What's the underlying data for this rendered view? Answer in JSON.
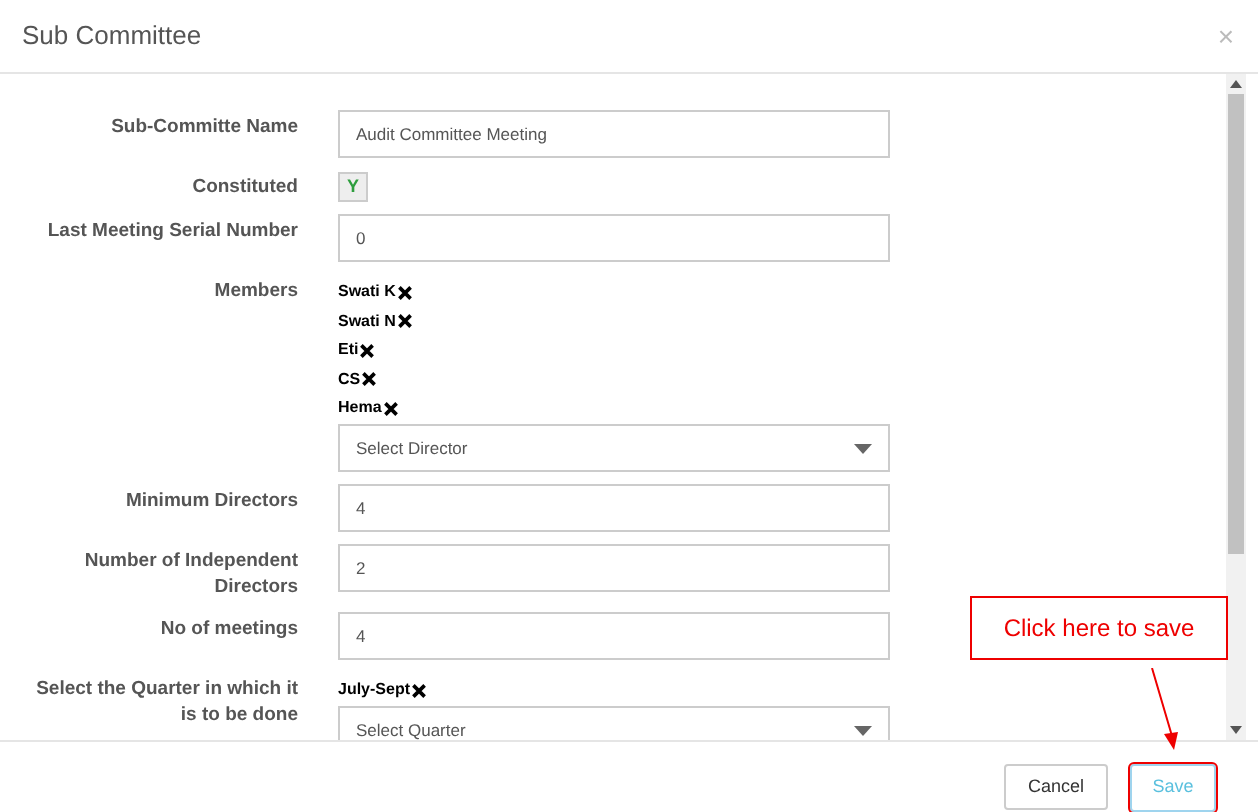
{
  "dialog": {
    "title": "Sub Committee",
    "close": "×"
  },
  "fields": [
    {
      "kind": "text",
      "label": "Sub-Committe Name",
      "value": "Audit Committee Meeting"
    },
    {
      "kind": "toggle",
      "label": "Constituted",
      "value": "Y",
      "on": true
    },
    {
      "kind": "text",
      "label": "Last Meeting Serial Number",
      "value": "0"
    },
    {
      "kind": "multi",
      "label": "Members",
      "tags": [
        "Swati K",
        "Swati N",
        "Eti",
        "CS",
        "Hema"
      ],
      "placeholder": "Select Director"
    },
    {
      "kind": "text",
      "label": "Minimum Directors",
      "value": "4"
    },
    {
      "kind": "text",
      "label": "Number of Independent Directors",
      "value": "2"
    },
    {
      "kind": "text",
      "label": "No of meetings",
      "value": "4"
    },
    {
      "kind": "multi",
      "label": "Select the Quarter in which it is to be done",
      "tags": [
        "July-Sept"
      ],
      "placeholder": "Select Quarter"
    }
  ],
  "footer": {
    "buttons": [
      "Cancel",
      "Save"
    ]
  },
  "annotation": {
    "text": "Click here to save"
  }
}
